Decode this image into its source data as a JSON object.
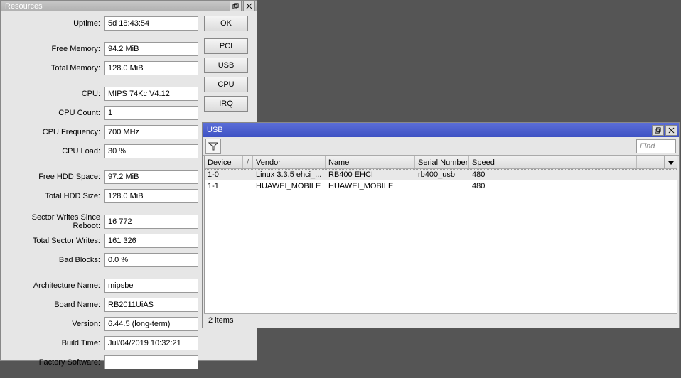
{
  "resources": {
    "title": "Resources",
    "buttons": {
      "ok": "OK",
      "pci": "PCI",
      "usb": "USB",
      "cpu": "CPU",
      "irq": "IRQ"
    },
    "fields": {
      "uptime": {
        "label": "Uptime:",
        "value": "5d 18:43:54"
      },
      "free_memory": {
        "label": "Free Memory:",
        "value": "94.2 MiB"
      },
      "total_memory": {
        "label": "Total Memory:",
        "value": "128.0 MiB"
      },
      "cpu": {
        "label": "CPU:",
        "value": "MIPS 74Kc V4.12"
      },
      "cpu_count": {
        "label": "CPU Count:",
        "value": "1"
      },
      "cpu_frequency": {
        "label": "CPU Frequency:",
        "value": "700 MHz"
      },
      "cpu_load": {
        "label": "CPU Load:",
        "value": "30 %"
      },
      "free_hdd": {
        "label": "Free HDD Space:",
        "value": "97.2 MiB"
      },
      "total_hdd": {
        "label": "Total HDD Size:",
        "value": "128.0 MiB"
      },
      "sector_writes_rb": {
        "label": "Sector Writes Since Reboot:",
        "value": "16 772"
      },
      "total_sector_wr": {
        "label": "Total Sector Writes:",
        "value": "161 326"
      },
      "bad_blocks": {
        "label": "Bad Blocks:",
        "value": "0.0 %"
      },
      "arch": {
        "label": "Architecture Name:",
        "value": "mipsbe"
      },
      "board": {
        "label": "Board Name:",
        "value": "RB2011UiAS"
      },
      "version": {
        "label": "Version:",
        "value": "6.44.5 (long-term)"
      },
      "build_time": {
        "label": "Build Time:",
        "value": "Jul/04/2019 10:32:21"
      },
      "factory_sw": {
        "label": "Factory Software:",
        "value": ""
      }
    }
  },
  "usb": {
    "title": "USB",
    "find_placeholder": "Find",
    "columns": {
      "device": "Device",
      "vendor": "Vendor",
      "name": "Name",
      "serial": "Serial Number",
      "speed": "Speed"
    },
    "rows": [
      {
        "device": "1-0",
        "vendor": "Linux 3.3.5 ehci_...",
        "name": "RB400 EHCI",
        "serial": "rb400_usb",
        "speed": "480"
      },
      {
        "device": "1-1",
        "vendor": "HUAWEI_MOBILE",
        "name": "HUAWEI_MOBILE",
        "serial": "",
        "speed": "480"
      }
    ],
    "status": "2 items"
  }
}
